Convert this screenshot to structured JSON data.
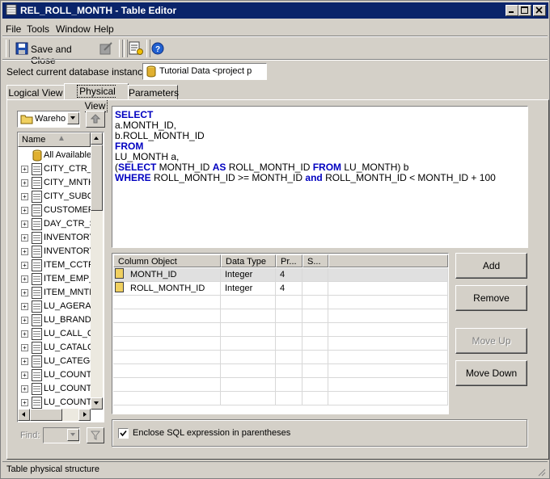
{
  "window": {
    "title": "REL_ROLL_MONTH - Table Editor"
  },
  "menu": {
    "file": "File",
    "tools": "Tools",
    "window": "Window",
    "help": "Help"
  },
  "toolbar": {
    "save_close_label": "Save and Close"
  },
  "db_instance": {
    "label": "Select current database instance",
    "value": "Tutorial Data <project p"
  },
  "tabs": [
    {
      "label": "Logical View"
    },
    {
      "label": "Physical View"
    },
    {
      "label": "Parameters"
    }
  ],
  "warehouse": {
    "selected": "Wareho"
  },
  "tree": {
    "header": "Name",
    "root": "All Available",
    "items": [
      "CITY_CTR_",
      "CITY_MNTH",
      "CITY_SUBC",
      "CUSTOMER",
      "DAY_CTR_S",
      "INVENTORY",
      "INVENTORY",
      "ITEM_CCTR",
      "ITEM_EMP_",
      "ITEM_MNTH",
      "LU_AGERAN",
      "LU_BRAND",
      "LU_CALL_C",
      "LU_CATALC",
      "LU_CATEGC",
      "LU_COUNTI",
      "LU_COUNTI",
      "LU_COUNTI"
    ]
  },
  "find": {
    "label": "Find:"
  },
  "sql": {
    "lines": [
      [
        {
          "t": "SELECT",
          "k": true
        }
      ],
      [
        {
          "t": "a.MONTH_ID,",
          "k": false
        }
      ],
      [
        {
          "t": "b.ROLL_MONTH_ID",
          "k": false
        }
      ],
      [
        {
          "t": "FROM",
          "k": true
        }
      ],
      [
        {
          "t": "LU_MONTH a,",
          "k": false
        }
      ],
      [
        {
          "t": "(",
          "k": false
        },
        {
          "t": "SELECT",
          "k": true
        },
        {
          "t": " MONTH_ID ",
          "k": false
        },
        {
          "t": "AS",
          "k": true
        },
        {
          "t": " ROLL_MONTH_ID ",
          "k": false
        },
        {
          "t": "FROM",
          "k": true
        },
        {
          "t": " LU_MONTH) b",
          "k": false
        }
      ],
      [
        {
          "t": "WHERE",
          "k": true
        },
        {
          "t": " ROLL_MONTH_ID >= MONTH_ID ",
          "k": false
        },
        {
          "t": "and",
          "k": true
        },
        {
          "t": " ROLL_MONTH_ID < MONTH_ID + 100",
          "k": false
        }
      ]
    ]
  },
  "grid": {
    "columns": [
      "Column Object",
      "Data Type",
      "Pr...",
      "S..."
    ],
    "rows": [
      {
        "name": "MONTH_ID",
        "type": "Integer",
        "precision": "4",
        "scale": ""
      },
      {
        "name": "ROLL_MONTH_ID",
        "type": "Integer",
        "precision": "4",
        "scale": ""
      }
    ]
  },
  "buttons": {
    "add": "Add",
    "remove": "Remove",
    "move_up": "Move Up",
    "move_down": "Move Down"
  },
  "enclose": {
    "label": "Enclose SQL expression in parentheses",
    "checked": true
  },
  "status": {
    "text": "Table physical structure"
  },
  "colors": {
    "title_bar": "#0a246a",
    "sql_keyword": "#0000c0",
    "selected_row": "#e0e0e0"
  }
}
